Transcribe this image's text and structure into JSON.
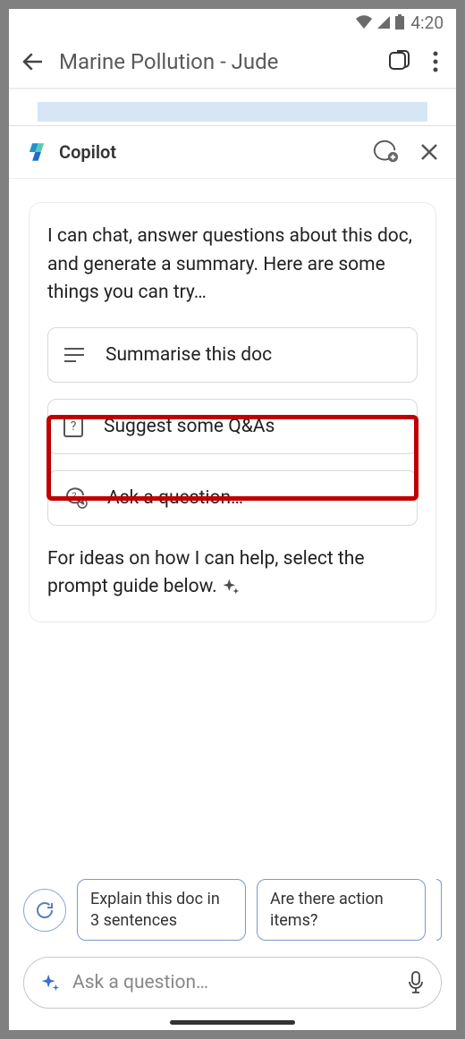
{
  "status": {
    "time": "4:20"
  },
  "header": {
    "title": "Marine Pollution - Jude"
  },
  "copilot": {
    "title": "Copilot",
    "intro": "I can chat, answer questions about this doc, and generate a summary. Here are some things you can try…",
    "options": {
      "summarise": "Summarise this doc",
      "qa": "Suggest some Q&As",
      "ask": "Ask a question…"
    },
    "outro": "For ideas on how I can help, select the prompt guide below. "
  },
  "chips": {
    "explain": "Explain this doc in 3 sentences",
    "actions": "Are there action items?"
  },
  "input": {
    "placeholder": "Ask a question…"
  }
}
